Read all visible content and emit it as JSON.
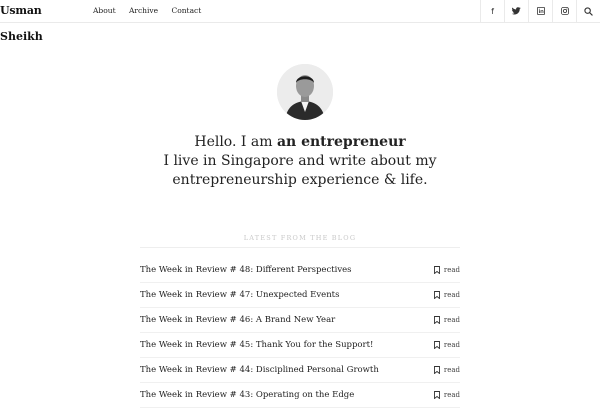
{
  "header": {
    "brand_line1": "Usman",
    "brand_line2": "Sheikh",
    "nav": [
      "About",
      "Archive",
      "Contact"
    ],
    "social_icons": [
      "facebook-icon",
      "twitter-icon",
      "linkedin-icon",
      "instagram-icon",
      "search-icon"
    ]
  },
  "hero": {
    "greeting": "Hello. I am",
    "role": "an entrepreneur",
    "line2": "I live in Singapore and write about my",
    "line3": "entrepreneurship experience & life."
  },
  "blog": {
    "section_title": "LATEST FROM THE BLOG",
    "read_label": "read",
    "posts": [
      "The Week in Review # 48: Different Perspectives",
      "The Week in Review # 47: Unexpected Events",
      "The Week in Review # 46: A Brand New Year",
      "The Week in Review # 45: Thank You for the Support!",
      "The Week in Review # 44: Disciplined Personal Growth",
      "The Week in Review # 43: Operating on the Edge"
    ]
  }
}
